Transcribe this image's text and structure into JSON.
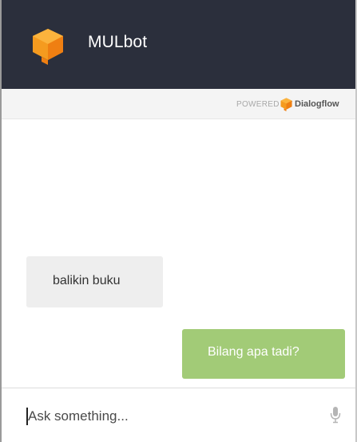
{
  "colors": {
    "header_bg": "#2b2f3c",
    "brand_orange": "#f59b1f",
    "user_bubble": "#a2cb77",
    "bot_bubble": "#eeeeee"
  },
  "header": {
    "logo_icon": "dialogflow-cube-icon",
    "title": "MULbot"
  },
  "powered_by": {
    "label": "POWERED BY",
    "brand_icon": "dialogflow-logo-icon",
    "brand": "Dialogflow"
  },
  "messages": [
    {
      "sender": "bot",
      "text": "balikin buku"
    },
    {
      "sender": "user",
      "text": "Bilang apa tadi?"
    }
  ],
  "input": {
    "value": "",
    "placeholder": "Ask something...",
    "mic_icon": "microphone-icon"
  }
}
